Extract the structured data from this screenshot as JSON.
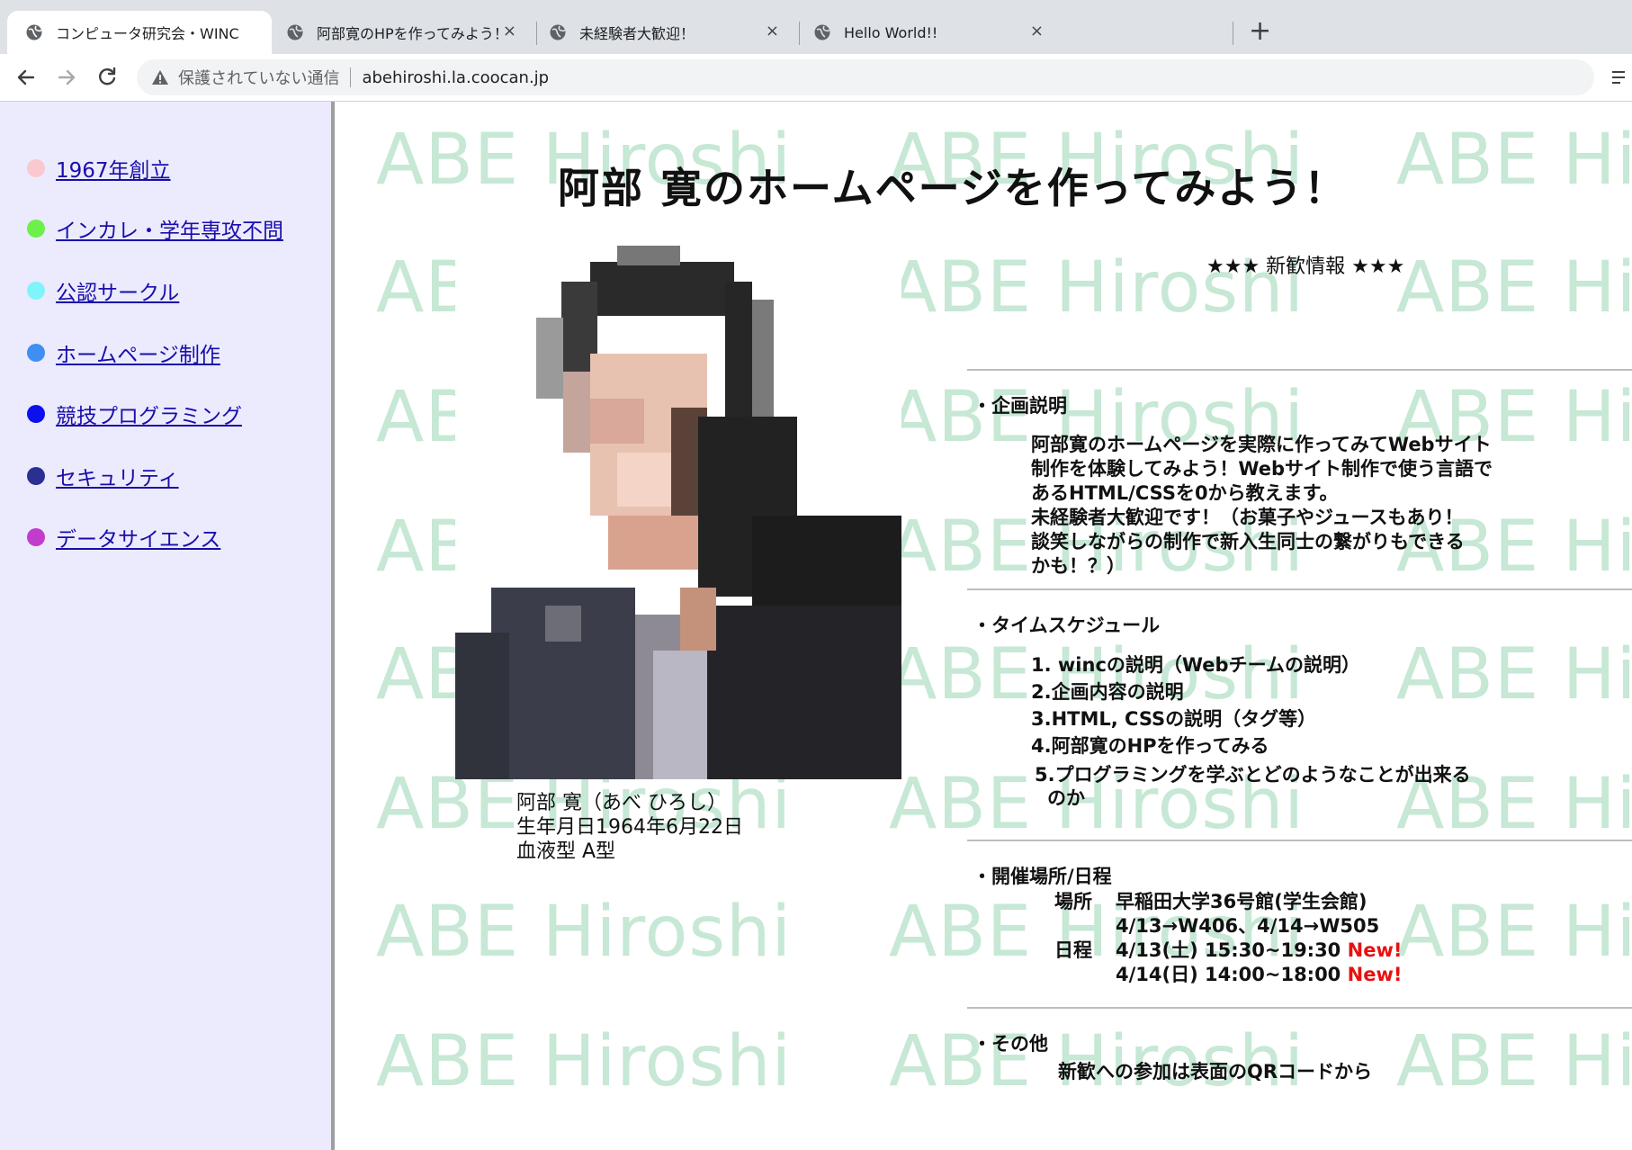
{
  "tabs": [
    {
      "title": "コンピュータ研究会・WINC",
      "active": true
    },
    {
      "title": "阿部寛のHPを作ってみよう！",
      "close": "×"
    },
    {
      "title": "未経験者大歓迎！",
      "close": "×"
    },
    {
      "title": "Hello World!!",
      "close": "×"
    }
  ],
  "new_tab": "+",
  "address_bar": {
    "security_text": "保護されていない通信",
    "url": "abehiroshi.la.coocan.jp"
  },
  "sidebar": {
    "items": [
      {
        "label": "1967年創立",
        "dot_color": "#f9c9cf"
      },
      {
        "label": "インカレ・学年専攻不問",
        "dot_color": "#6ef04a"
      },
      {
        "label": "公認サークル",
        "dot_color": "#7ff5fb"
      },
      {
        "label": "ホームページ制作",
        "dot_color": "#3f8ff3"
      },
      {
        "label": "競技プログラミング",
        "dot_color": "#0c10ef"
      },
      {
        "label": "セキュリティ",
        "dot_color": "#2c2f92"
      },
      {
        "label": "データサイエンス",
        "dot_color": "#c23ccc"
      }
    ]
  },
  "watermark": "ABE Hiroshi",
  "main": {
    "title": "阿部 寛のホームページを作ってみよう！",
    "caption": [
      "阿部 寛（あべ ひろし）",
      "生年月日1964年6月22日",
      "血液型 A型"
    ],
    "news_heading": "★★★ 新歓情報 ★★★",
    "sections": {
      "plan": {
        "title": "・企画説明",
        "lines": [
          "阿部寛のホームページを実際に作ってみてWebサイト",
          "制作を体験してみよう！Webサイト制作で使う言語で",
          "あるHTML/CSSを0から教えます。",
          "未経験者大歓迎です！（お菓子やジュースもあり！",
          "談笑しながらの制作で新入生同士の繋がりもできる",
          "かも！？）"
        ]
      },
      "schedule": {
        "title": "・タイムスケジュール",
        "items": [
          "1. wincの説明（Webチームの説明）",
          "2.企画内容の説明",
          "3.HTML, CSSの説明（タグ等）",
          "4.阿部寛のHPを作ってみる",
          "5.プログラミングを学ぶとどのようなことが出来る",
          "のか"
        ]
      },
      "venue": {
        "title": "・開催場所/日程",
        "place_label": "場所",
        "place_lines": [
          "早稲田大学36号館(学生会館)",
          "4/13→W406、4/14→W505"
        ],
        "date_label": "日程",
        "dates": [
          {
            "text": "4/13(土) 15:30~19:30",
            "badge": "New!"
          },
          {
            "text": "4/14(日) 14:00~18:00",
            "badge": "New!"
          }
        ]
      },
      "other": {
        "title": "・その他",
        "text": "新歓への参加は表面のQRコードから"
      }
    }
  },
  "colors": {
    "new_badge": "#e81010",
    "watermark": "#c6e8d5",
    "sidebar_bg": "#ebebfd",
    "link": "#1a0dab"
  }
}
